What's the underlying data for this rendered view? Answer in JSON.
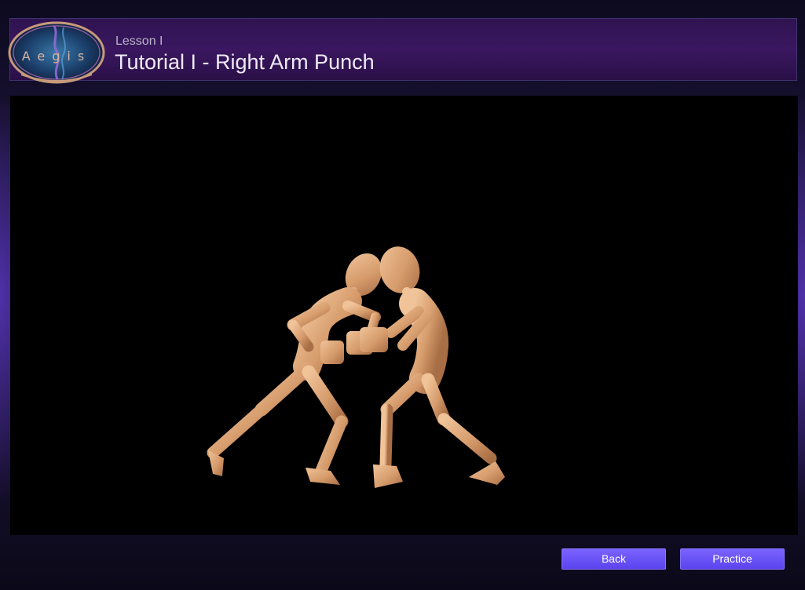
{
  "header": {
    "logo_text": "Aegis",
    "lesson_label": "Lesson I",
    "title": "Tutorial I - Right Arm Punch"
  },
  "viewport": {
    "scene": "two-figure-sparring-animation"
  },
  "footer": {
    "back_label": "Back",
    "practice_label": "Practice"
  },
  "colors": {
    "accent": "#6a52f5",
    "header_bg": "#341457",
    "figure_skin": "#d9a476"
  }
}
